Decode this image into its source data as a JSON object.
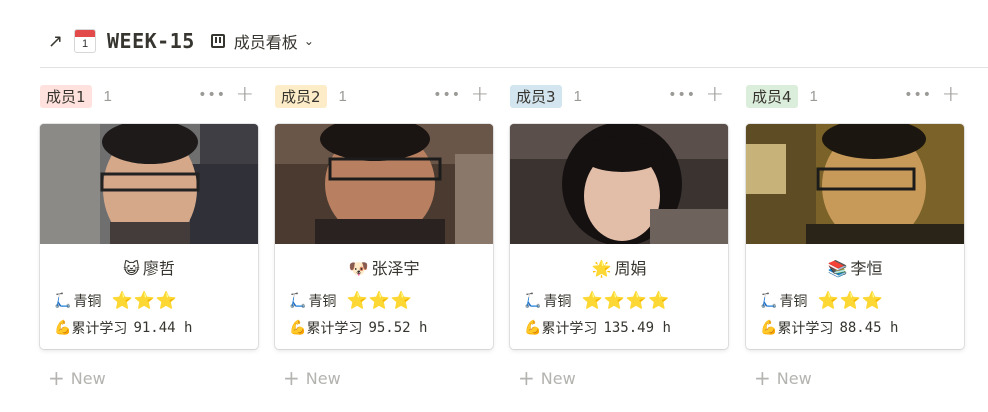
{
  "header": {
    "arrow": "↗",
    "calendar_month": "",
    "calendar_day": "1",
    "title": "WEEK-15",
    "view_name": "成员看板",
    "view_chevron": "⌄"
  },
  "columns": [
    {
      "tag": "成员1",
      "tag_color": "#ffe2dd",
      "count": "1",
      "card": {
        "emoji": "😺",
        "name": "廖哲",
        "rank": "青铜",
        "stars": "⭐⭐⭐",
        "study_label": "累计学习",
        "hours": "91.44 h"
      }
    },
    {
      "tag": "成员2",
      "tag_color": "#fdecc8",
      "count": "1",
      "card": {
        "emoji": "🐶",
        "name": "张泽宇",
        "rank": "青铜",
        "stars": "⭐⭐⭐",
        "study_label": "累计学习",
        "hours": "95.52 h"
      }
    },
    {
      "tag": "成员3",
      "tag_color": "#d3e5ef",
      "count": "1",
      "card": {
        "emoji": "🌟",
        "name": "周娟",
        "rank": "青铜",
        "stars": "⭐⭐⭐⭐",
        "study_label": "累计学习",
        "hours": "135.49 h"
      }
    },
    {
      "tag": "成员4",
      "tag_color": "#dbeddb",
      "count": "1",
      "card": {
        "emoji": "📚",
        "name": "李恒",
        "rank": "青铜",
        "stars": "⭐⭐⭐",
        "study_label": "累计学习",
        "hours": "88.45 h"
      }
    }
  ],
  "labels": {
    "new": "New",
    "more": "•••",
    "add": "+",
    "scooter": "🛴",
    "muscle": "💪"
  }
}
